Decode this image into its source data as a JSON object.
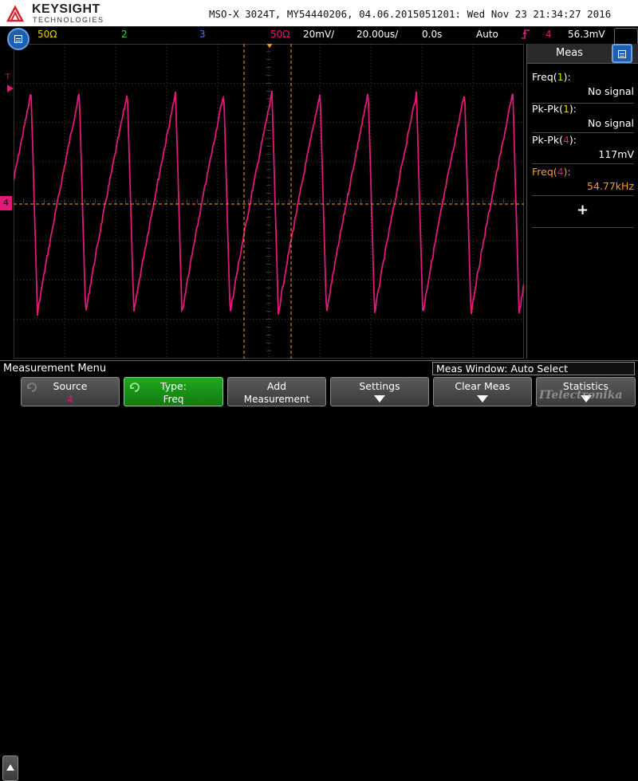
{
  "header": {
    "brand_name": "KEYSIGHT",
    "brand_sub": "TECHNOLOGIES",
    "instrument_info": "MSO-X 3024T, MY54440206, 04.06.2015051201: Wed Nov 23 21:34:27 2016"
  },
  "status": {
    "ch1": "50Ω",
    "ch2": "2",
    "ch3": "3",
    "ch4": "50Ω",
    "vdiv": "20mV/",
    "tdiv": "20.00us/",
    "delay": "0.0s",
    "trigger_mode": "Auto",
    "trigger_slope_icon": "rising-edge-icon",
    "trigger_source": "4",
    "trigger_level": "56.3mV"
  },
  "colors": {
    "ch1": "#e8d200",
    "ch2": "#3cd13c",
    "ch3": "#4f6fff",
    "ch4": "#e0197a",
    "grid": "#555555",
    "accent_orange": "#ff9b1a"
  },
  "markers": {
    "trigger_marker": "T",
    "ch4_marker": "4"
  },
  "measurements": {
    "title": "Meas",
    "items": [
      {
        "label": "Freq(",
        "channel": "1",
        "label_end": "):",
        "value": "No signal",
        "highlight": false
      },
      {
        "label": "Pk-Pk(",
        "channel": "1",
        "label_end": "):",
        "value": "No signal",
        "highlight": false
      },
      {
        "label": "Pk-Pk(",
        "channel": "4",
        "label_end": "):",
        "value": "117mV",
        "highlight": false
      },
      {
        "label": "Freq(",
        "channel": "4",
        "label_end": "):",
        "value": "54.77kHz",
        "highlight": true
      }
    ],
    "add_label": "+"
  },
  "menu": {
    "title": "Measurement Menu",
    "window_label": "Meas Window: Auto Select"
  },
  "softkeys": {
    "source_l1": "Source",
    "source_l2": "4",
    "type_l1": "Type:",
    "type_l2": "Freq",
    "add_l1": "Add",
    "add_l2": "Measurement",
    "settings_l1": "Settings",
    "clear_l1": "Clear Meas",
    "stats_l1": "Statistics"
  },
  "watermark": "ITelectronika"
}
